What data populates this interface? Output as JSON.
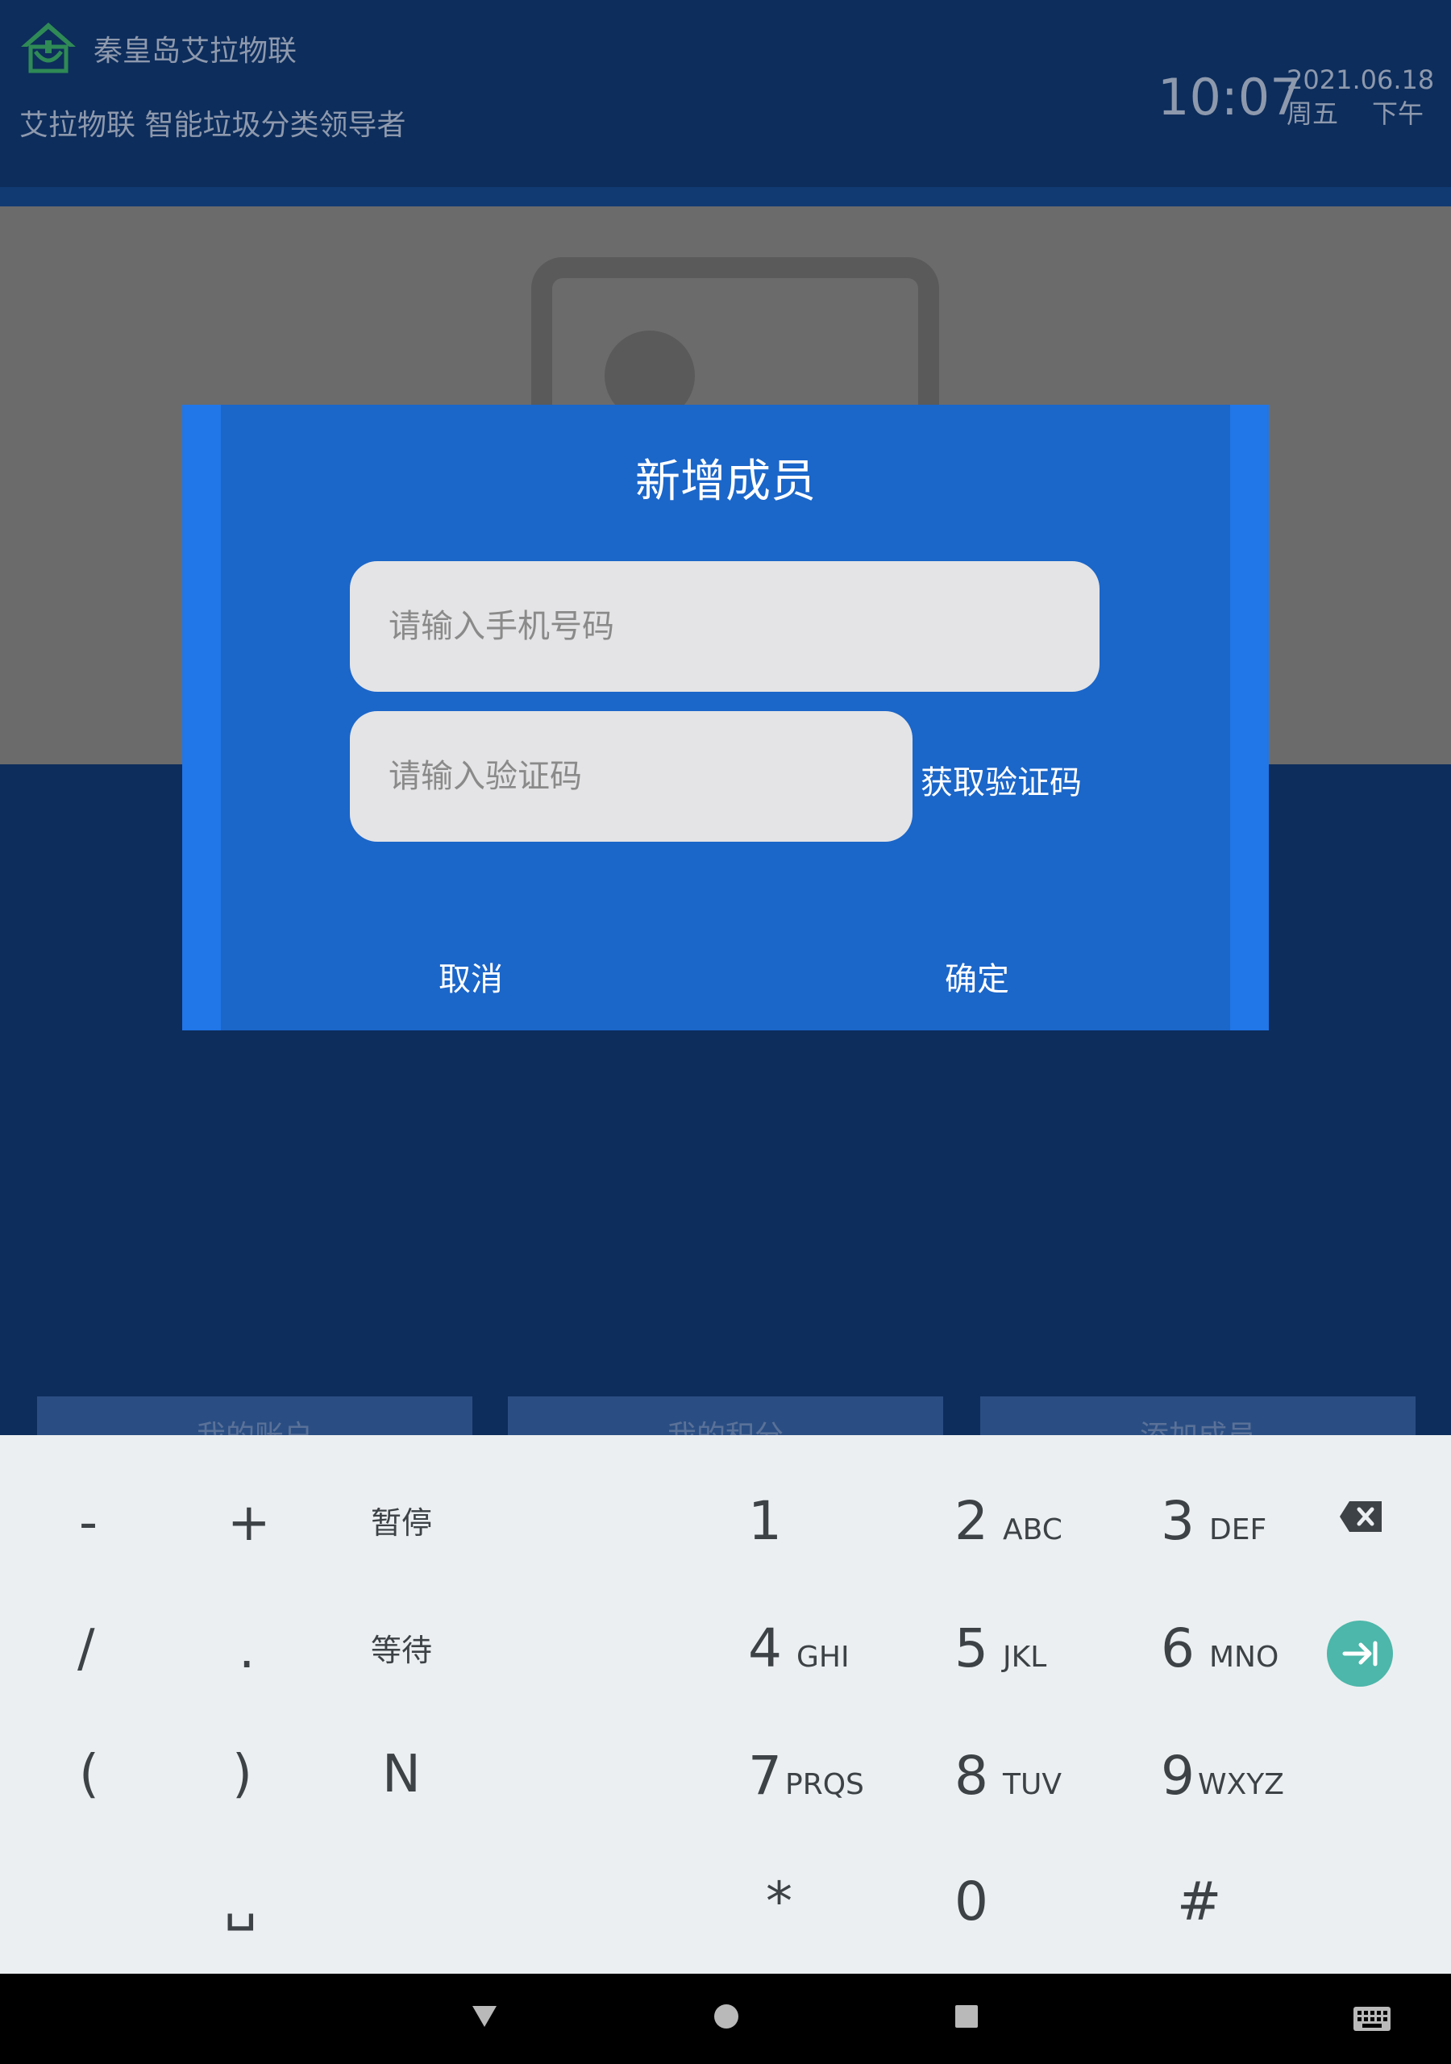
{
  "header": {
    "company_name": "秦皇岛艾拉物联",
    "slogan": "艾拉物联 智能垃圾分类领导者",
    "time": "10:07",
    "date": "2021.06.18",
    "weekday": "周五",
    "ampm": "下午"
  },
  "bottom_tabs": [
    {
      "label": "我的账户"
    },
    {
      "label": "我的积分"
    },
    {
      "label": "添加成员"
    }
  ],
  "dialog": {
    "title": "新增成员",
    "phone_placeholder": "请输入手机号码",
    "phone_value": "",
    "code_placeholder": "请输入验证码",
    "code_value": "",
    "get_code_label": "获取验证码",
    "cancel_label": "取消",
    "confirm_label": "确定"
  },
  "keyboard": {
    "left_keys": [
      "-",
      "+",
      "暂停",
      "/",
      ".",
      "等待",
      "(",
      ")",
      "N",
      "␣"
    ],
    "digits": [
      {
        "num": "1",
        "letters": ""
      },
      {
        "num": "2",
        "letters": "ABC"
      },
      {
        "num": "3",
        "letters": "DEF"
      },
      {
        "num": "4",
        "letters": "GHI"
      },
      {
        "num": "5",
        "letters": "JKL"
      },
      {
        "num": "6",
        "letters": "MNO"
      },
      {
        "num": "7",
        "letters": "PRQS"
      },
      {
        "num": "8",
        "letters": "TUV"
      },
      {
        "num": "9",
        "letters": "WXYZ"
      },
      {
        "num": "*",
        "letters": ""
      },
      {
        "num": "0",
        "letters": ""
      },
      {
        "num": "#",
        "letters": ""
      }
    ],
    "backspace_icon": "backspace-icon",
    "enter_icon": "next-field-icon",
    "enter_color": "#4cb7aa"
  },
  "navbar": {
    "back_icon": "back-icon",
    "home_icon": "home-icon",
    "recents_icon": "recents-icon",
    "keyboard_icon": "keyboard-icon"
  }
}
